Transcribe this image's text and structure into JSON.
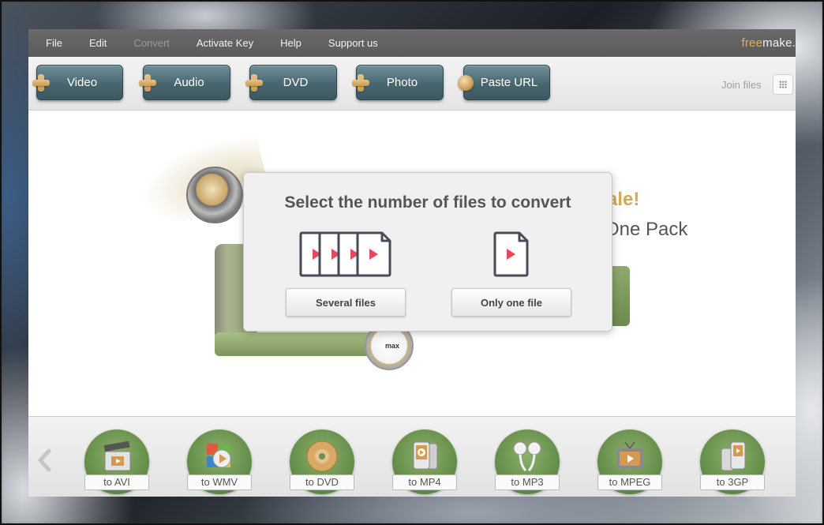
{
  "menu": {
    "items": [
      "File",
      "Edit",
      "Convert",
      "Activate Key",
      "Help",
      "Support us"
    ],
    "disabled_item": "Convert",
    "logo_free": "free",
    "logo_make": "make."
  },
  "toolbar": {
    "buttons": [
      "Video",
      "Audio",
      "DVD",
      "Photo",
      "Paste URL"
    ],
    "join_label": "Join files"
  },
  "promo": {
    "sale_fragment": "ale!",
    "pack_fragment": "One Pack"
  },
  "modal": {
    "title": "Select the number of files to convert",
    "several_label": "Several files",
    "one_label": "Only one file"
  },
  "formats": {
    "items": [
      "to AVI",
      "to WMV",
      "to DVD",
      "to MP4",
      "to MP3",
      "to MPEG",
      "to 3GP"
    ]
  },
  "illustration": {
    "dial_label": "max"
  },
  "colors": {
    "accent_play": "#e8475d",
    "button_teal": "#48666f",
    "format_green": "#5f8a45",
    "logo_gold": "#d7b25b"
  }
}
